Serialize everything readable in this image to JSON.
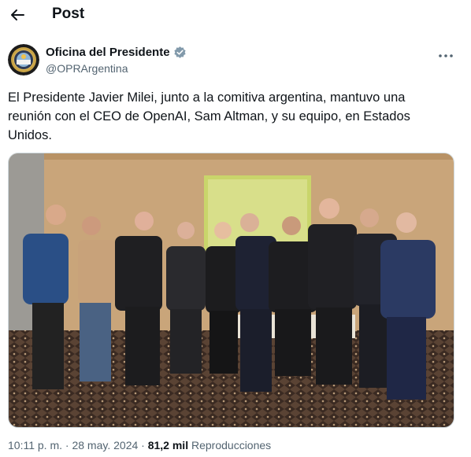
{
  "header": {
    "title": "Post",
    "back_icon": "arrow-left-icon"
  },
  "author": {
    "display_name": "Oficina del Presidente",
    "handle": "@OPRArgentina",
    "verified_badge_color": "#829aab",
    "avatar_icon": "presidential-seal-icon"
  },
  "post": {
    "text": "El Presidente Javier Milei, junto a la comitiva argentina, mantuvo una reunión con el CEO de OpenAI, Sam Altman, y su equipo, en Estados Unidos."
  },
  "meta": {
    "time": "10:11 p. m.",
    "separator": "·",
    "date": "28 may. 2024",
    "views_count": "81,2 mil",
    "views_label": "Reproducciones"
  },
  "colors": {
    "text": "#0f1419",
    "secondary_text": "#536471",
    "border": "#cfd9de"
  }
}
